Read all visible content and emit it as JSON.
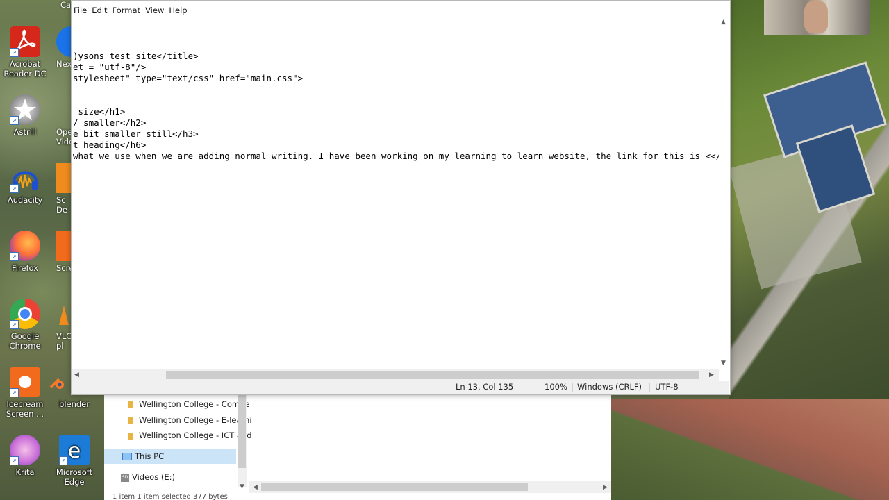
{
  "desktop": {
    "icons": [
      {
        "label": "Acrobat Reader DC",
        "icon": "acrobat-icon",
        "color": "#d5281b"
      },
      {
        "label": "Astrill",
        "icon": "astrill-star-icon",
        "color": "#c9c9c9"
      },
      {
        "label": "Audacity",
        "icon": "audacity-headphones-icon",
        "color": "#1e4fd1"
      },
      {
        "label": "Firefox",
        "icon": "firefox-icon",
        "color": "#ff7139"
      },
      {
        "label": "Google Chrome",
        "icon": "chrome-icon",
        "color": "#34a853"
      },
      {
        "label": "Icecream Screen ...",
        "icon": "icecream-icon",
        "color": "#f26b1d"
      },
      {
        "label": "Krita",
        "icon": "krita-icon",
        "color": "#c86dd7"
      }
    ],
    "icons_col2": [
      {
        "label": "Microsoft Edge",
        "icon": "edge-icon",
        "color": "#1b7bd6"
      },
      {
        "label": "blender",
        "icon": "blender-icon",
        "color": "#f5792a"
      }
    ],
    "partial_labels": [
      "Ca",
      "Nex",
      "Ope Vide",
      "Sc De",
      "Scre",
      "VLC pl"
    ]
  },
  "notepad": {
    "menu": [
      "File",
      "Edit",
      "Format",
      "View",
      "Help"
    ],
    "lines": [
      "",
      "",
      "",
      ")ysons test site</title>",
      "et = \"utf-8\"/>",
      "stylesheet\" type=\"text/css\" href=\"main.css\">",
      "",
      "",
      " size</h1>",
      "/ smaller</h2>",
      "e bit smaller still</h3>",
      "t heading</h6>",
      "what we use when we are adding normal writing. I have been working on my learning to learn website, the link for this is <</"
    ],
    "status": {
      "position": "Ln 13, Col 135",
      "zoom": "100%",
      "line_endings": "Windows (CRLF)",
      "encoding": "UTF-8"
    }
  },
  "explorer": {
    "folders": [
      "Wellington College - Combe",
      "Wellington College - E-learni",
      "Wellington College - ICT and"
    ],
    "this_pc": "This PC",
    "drive": "Videos (E:)",
    "drive_badge": "SD",
    "status_text": "1 item    1 item selected  377 bytes"
  }
}
